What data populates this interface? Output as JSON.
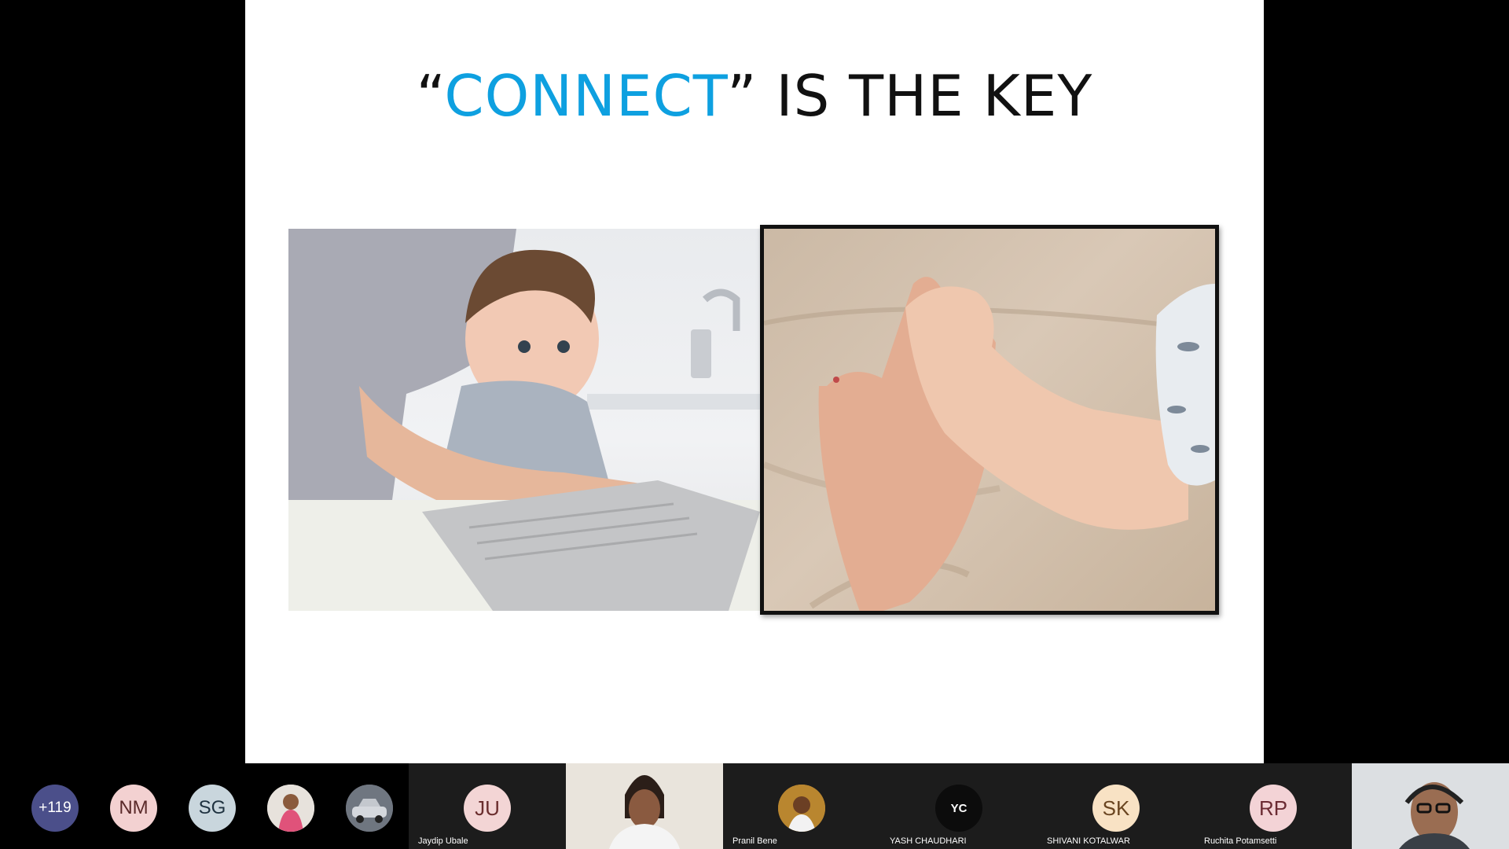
{
  "slide": {
    "title_open_quote": "“",
    "title_accent": "CONNECT",
    "title_rest": "” IS THE KEY",
    "accent_color": "#0ea0e0",
    "photo_left": "mother and baby at laptop photo",
    "photo_right": "adult hand holding baby hand photo"
  },
  "participants": {
    "overflow_count": "+119",
    "mini": [
      {
        "initials": "NM"
      },
      {
        "initials": "SG"
      }
    ],
    "tiles": [
      {
        "initials": "JU",
        "name": "Jaydip Ubale"
      },
      {
        "name": ""
      },
      {
        "name": "Pranil Bene"
      },
      {
        "initials": "YC",
        "name": "YASH CHAUDHARI"
      },
      {
        "initials": "SK",
        "name": "SHIVANI KOTALWAR"
      },
      {
        "initials": "RP",
        "name": "Ruchita Potamsetti"
      }
    ]
  }
}
